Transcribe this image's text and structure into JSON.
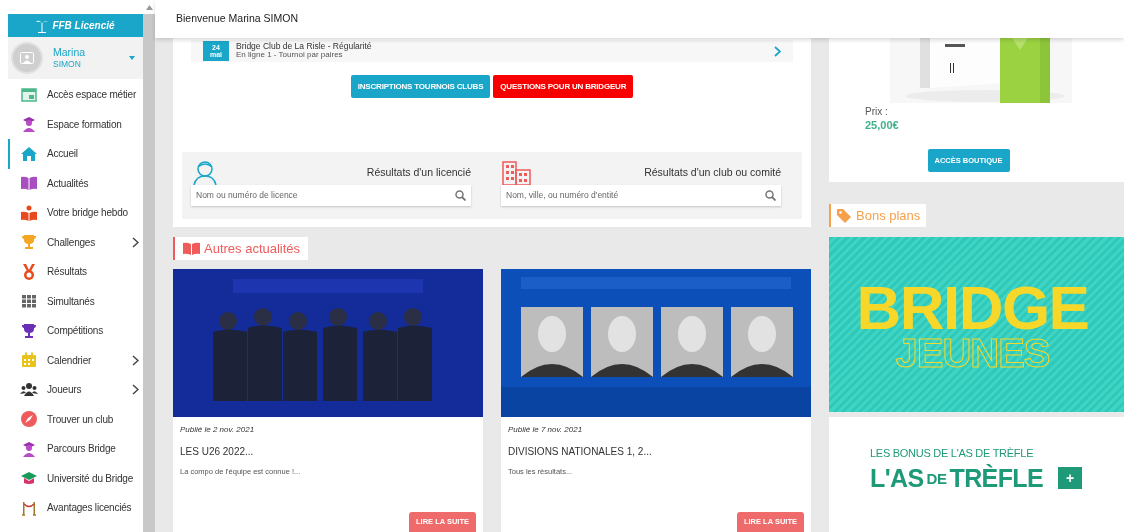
{
  "sidebar": {
    "brand": "FFB Licencié",
    "user": {
      "first_name": "Marina",
      "last_name": "SIMON"
    },
    "items": [
      {
        "label": "Accès espace métier",
        "selected": false,
        "has_submenu": false
      },
      {
        "label": "Espace formation",
        "selected": false,
        "has_submenu": false
      },
      {
        "label": "Accueil",
        "selected": true,
        "has_submenu": false
      },
      {
        "label": "Actualités",
        "selected": false,
        "has_submenu": false
      },
      {
        "label": "Votre bridge hebdo",
        "selected": false,
        "has_submenu": false
      },
      {
        "label": "Challenges",
        "selected": false,
        "has_submenu": true
      },
      {
        "label": "Résultats",
        "selected": false,
        "has_submenu": false
      },
      {
        "label": "Simultanés",
        "selected": false,
        "has_submenu": false
      },
      {
        "label": "Compétitions",
        "selected": false,
        "has_submenu": false
      },
      {
        "label": "Calendrier",
        "selected": false,
        "has_submenu": true
      },
      {
        "label": "Joueurs",
        "selected": false,
        "has_submenu": true
      },
      {
        "label": "Trouver un club",
        "selected": false,
        "has_submenu": false
      },
      {
        "label": "Parcours Bridge",
        "selected": false,
        "has_submenu": false
      },
      {
        "label": "Université du Bridge",
        "selected": false,
        "has_submenu": false
      },
      {
        "label": "Avantages licenciés",
        "selected": false,
        "has_submenu": false
      }
    ]
  },
  "header": {
    "welcome": "Bienvenue Marina SIMON"
  },
  "tournament": {
    "day": "24",
    "month": "mai",
    "title": "Bridge Club de La Risle - Régularité",
    "subtitle": "En ligne 1 - Tournoi par paires"
  },
  "actions": [
    {
      "label": "INSCRIPTIONS TOURNOIS CLUBS",
      "kind": "primary"
    },
    {
      "label": "QUESTIONS POUR UN BRIDGEUR",
      "kind": "danger"
    }
  ],
  "search": [
    {
      "title": "Résultats d'un licencié",
      "placeholder": "Nom ou numéro de licence"
    },
    {
      "title": "Résultats d'un club ou comité",
      "placeholder": "Nom, ville, ou numéro d'entité"
    }
  ],
  "shop": {
    "price_label": "Prix :",
    "price": "25,00€",
    "button": "ACCÈS BOUTIQUE"
  },
  "news": {
    "title": "Autres actualités",
    "articles": [
      {
        "date": "Publié le 2 nov. 2021",
        "title": "LES U26 2022...",
        "summary": "La compo de l'équipe est connue !...",
        "button": "LIRE LA SUITE"
      },
      {
        "date": "Publié le 7 nov. 2021",
        "title": "DIVISIONS NATIONALES 1, 2...",
        "summary": "Tous les résultats...",
        "button": "LIRE LA SUITE"
      }
    ]
  },
  "deals": {
    "title": "Bons plans",
    "banner": {
      "line1": "BRIDGE",
      "line2": "JEUNES"
    },
    "promo": {
      "caption": "LES BONUS DE L'AS DE TRÈFLE",
      "logo_parts": [
        "L'AS",
        "DE",
        "TRÈFLE"
      ],
      "button": "+"
    }
  }
}
